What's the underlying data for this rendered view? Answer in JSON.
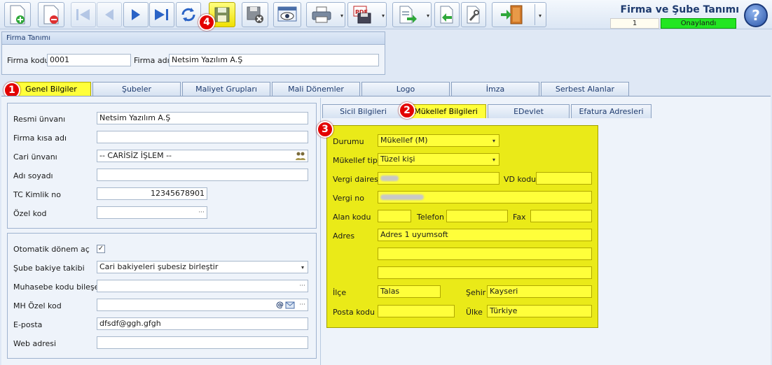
{
  "header": {
    "title": "Firma ve Şube Tanımı",
    "record_no": "1",
    "status": "Onaylandı"
  },
  "toolbar": {
    "buttons": [
      {
        "name": "new-record-button",
        "icon": "new-doc-icon"
      },
      {
        "name": "delete-record-button",
        "icon": "delete-doc-icon"
      },
      {
        "name": "first-record-button",
        "icon": "first-icon"
      },
      {
        "name": "prev-record-button",
        "icon": "prev-icon"
      },
      {
        "name": "next-record-button",
        "icon": "next-icon"
      },
      {
        "name": "last-record-button",
        "icon": "last-icon"
      },
      {
        "name": "refresh-button",
        "icon": "refresh-icon"
      },
      {
        "name": "save-button",
        "icon": "save-icon"
      },
      {
        "name": "cancel-save-button",
        "icon": "save-cancel-icon"
      },
      {
        "name": "preview-button",
        "icon": "preview-icon"
      },
      {
        "name": "print-button",
        "icon": "printer-icon"
      },
      {
        "name": "pdf-button",
        "icon": "pdf-icon"
      },
      {
        "name": "export-button",
        "icon": "export-icon"
      },
      {
        "name": "import-button",
        "icon": "import-icon"
      },
      {
        "name": "tools-button",
        "icon": "tools-icon"
      },
      {
        "name": "exit-button",
        "icon": "exit-door-icon"
      }
    ]
  },
  "firma": {
    "group_title": "Firma Tanımı",
    "code_label": "Firma kodu",
    "code_value": "0001",
    "name_label": "Firma adı",
    "name_value": "Netsim Yazılım A.Ş"
  },
  "main_tabs": [
    "Genel Bilgiler",
    "Şubeler",
    "Maliyet Grupları",
    "Mali Dönemler",
    "Logo",
    "İmza",
    "Serbest Alanlar"
  ],
  "general": {
    "resmi_unvan_label": "Resmi ünvanı",
    "resmi_unvan_value": "Netsim Yazılım A.Ş",
    "kisa_ad_label": "Firma kısa adı",
    "kisa_ad_value": "",
    "cari_unvan_label": "Cari ünvanı",
    "cari_unvan_value": "-- CARİSİZ İŞLEM --",
    "adi_soyadi_label": "Adı soyadı",
    "adi_soyadi_value": "",
    "tc_label": "TC Kimlik no",
    "tc_value": "12345678901",
    "ozel_kod_label": "Özel kod",
    "ozel_kod_value": ""
  },
  "general2": {
    "oto_donem_label": "Otomatik dönem aç",
    "oto_donem_checked": "✓",
    "sube_bakiye_label": "Şube bakiye takibi",
    "sube_bakiye_value": "Cari bakiyeleri şubesiz birleştir",
    "muh_kod_label": "Muhasebe kodu bileşeni",
    "muh_kod_value": "",
    "mh_ozel_label": "MH Özel kod",
    "mh_ozel_value": "",
    "eposta_label": "E-posta",
    "eposta_value": "dfsdf@ggh.gfgh",
    "web_label": "Web adresi",
    "web_value": ""
  },
  "sub_tabs": [
    "Sicil Bilgileri",
    "Mükellef Bilgileri",
    "EDevlet",
    "Efatura Adresleri"
  ],
  "mukellef": {
    "durum_label": "Durumu",
    "durum_value": "Mükellef (M)",
    "tip_label": "Mükellef tipi",
    "tip_value": "Tüzel kişi",
    "vd_label": "Vergi dairesi",
    "vd_kodu_label": "VD kodu",
    "vno_label": "Vergi no",
    "alan_label": "Alan kodu",
    "tel_label": "Telefon",
    "fax_label": "Fax",
    "adres_label": "Adres",
    "adres1": "Adres 1 uyumsoft",
    "ilce_label": "İlçe",
    "ilce_value": "Talas",
    "sehir_label": "Şehir",
    "sehir_value": "Kayseri",
    "posta_label": "Posta kodu",
    "ulke_label": "Ülke",
    "ulke_value": "Türkiye"
  },
  "badges": [
    "1",
    "2",
    "3",
    "4"
  ],
  "icons": {
    "dots": "···",
    "caret": "▾",
    "help": "?",
    "at": "@"
  }
}
